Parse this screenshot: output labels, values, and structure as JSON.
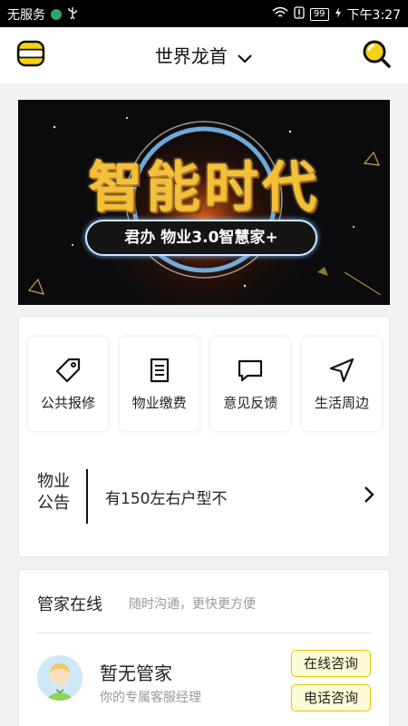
{
  "status_bar": {
    "carrier": "无服务",
    "usb_icon": "usb-icon",
    "battery": "99",
    "time": "下午3:27"
  },
  "header": {
    "title": "世界龙首",
    "menu_icon": "menu-icon",
    "search_icon": "search-icon",
    "accent": "#f7d117"
  },
  "banner": {
    "title": "智能时代",
    "subtitle": "君办 物业3.0智慧家+"
  },
  "services": [
    {
      "label": "公共报修",
      "icon": "tag-icon"
    },
    {
      "label": "物业缴费",
      "icon": "document-icon"
    },
    {
      "label": "意见反馈",
      "icon": "chat-icon"
    },
    {
      "label": "生活周边",
      "icon": "navigation-icon"
    }
  ],
  "notice": {
    "title": "物业公告",
    "text": "有150左右户型不"
  },
  "butler": {
    "title": "管家在线",
    "subtitle": "随时沟通，更快更方便",
    "name": "暂无管家",
    "role": "你的专属客服经理",
    "online_button": "在线咨询",
    "phone_button": "电话咨询"
  }
}
